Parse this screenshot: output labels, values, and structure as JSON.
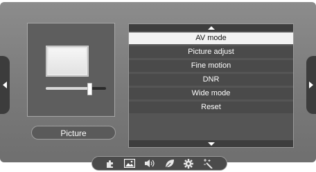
{
  "preview": {
    "label": "Picture",
    "slider_level": 0.75
  },
  "menu": {
    "selected_index": 0,
    "items": [
      {
        "label": "AV mode"
      },
      {
        "label": "Picture adjust"
      },
      {
        "label": "Fine motion"
      },
      {
        "label": "DNR"
      },
      {
        "label": "Wide mode"
      },
      {
        "label": "Reset"
      }
    ]
  },
  "bottom_bar": {
    "icons": [
      "setup-puzzle-icon",
      "picture-icon",
      "audio-icon",
      "eco-leaf-icon",
      "settings-gear-icon",
      "magic-wand-icon"
    ]
  },
  "colors": {
    "panel": "#7f7f7f",
    "menu_bg": "#555555",
    "selected_bg": "#f2f2f2"
  }
}
